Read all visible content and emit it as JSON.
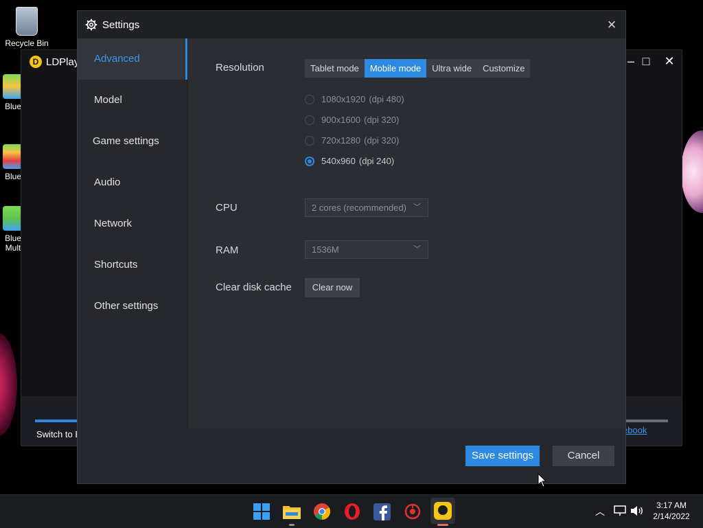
{
  "desktop": {
    "recycle_bin_label": "Recycle Bin",
    "bluestacks_label_1": "Blue",
    "bluestacks_label_2": "Blue",
    "bluestacks_label_3a": "Blue",
    "bluestacks_label_3b": "Mult"
  },
  "ldplayer": {
    "title": "LDPlay",
    "switch_text": "Switch to E",
    "link_text": "ebook"
  },
  "settings": {
    "title": "Settings",
    "close_glyph": "×",
    "sidebar": [
      {
        "label": "Advanced",
        "active": true
      },
      {
        "label": "Model"
      },
      {
        "label": "Game settings"
      },
      {
        "label": "Audio"
      },
      {
        "label": "Network"
      },
      {
        "label": "Shortcuts"
      },
      {
        "label": "Other settings"
      }
    ],
    "resolution_label": "Resolution",
    "resolution_modes": [
      "Tablet mode",
      "Mobile mode",
      "Ultra wide",
      "Customize"
    ],
    "resolution_selected_mode": "Mobile mode",
    "resolution_options": [
      {
        "size": "1080x1920",
        "dpi": "(dpi 480)"
      },
      {
        "size": "900x1600",
        "dpi": "(dpi 320)"
      },
      {
        "size": "720x1280",
        "dpi": "(dpi 320)"
      },
      {
        "size": "540x960",
        "dpi": "(dpi 240)",
        "selected": true
      }
    ],
    "cpu_label": "CPU",
    "cpu_value": "2 cores (recommended)",
    "ram_label": "RAM",
    "ram_value": "1536M",
    "clear_cache_label": "Clear disk cache",
    "clear_now_button": "Clear now",
    "save_button": "Save settings",
    "cancel_button": "Cancel"
  },
  "taskbar": {
    "time": "3:17 AM",
    "date": "2/14/2022"
  },
  "colors": {
    "accent": "#2d8ae0",
    "dialog_bg": "#2b2d33",
    "sidebar_bg": "#26282d"
  }
}
